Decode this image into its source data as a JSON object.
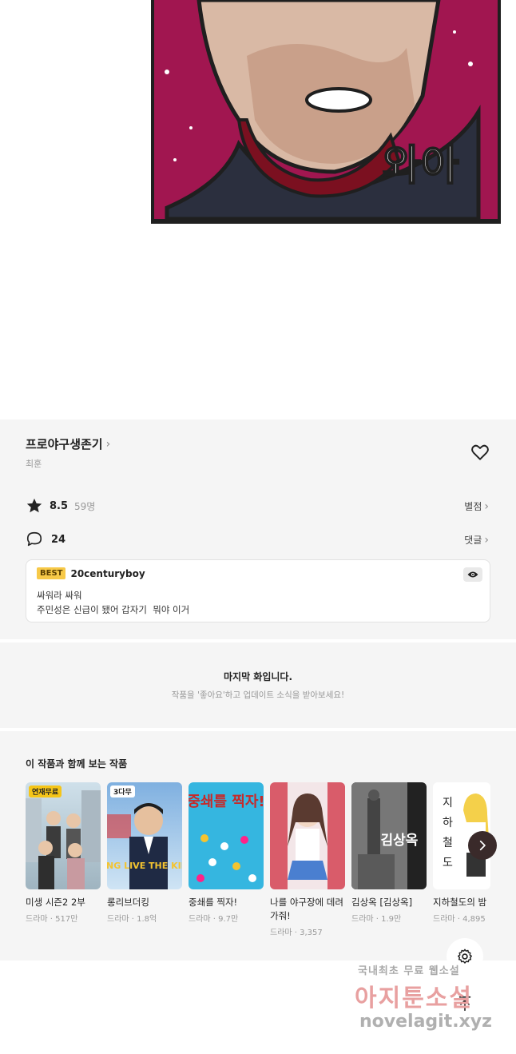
{
  "comic": {
    "panel_text": "와아"
  },
  "series": {
    "title": "프로야구생존기",
    "author": "최훈",
    "rating": "8.5",
    "rating_count": "59명",
    "rating_link": "별점",
    "comment_count": "24",
    "comment_link": "댓글"
  },
  "best_comment": {
    "badge": "BEST",
    "user": "20centuryboy",
    "lines": [
      "싸워라 싸워",
      "주민성은 신급이 됐어 갑자기  뭐야 이거"
    ]
  },
  "last_chapter": {
    "title": "마지막 화입니다.",
    "subtitle": "작품을 '좋아요'하고 업데이트 소식을 받아보세요!"
  },
  "recommendations": {
    "heading": "이 작품과 함께 보는 작품",
    "items": [
      {
        "name": "미생 시즌2 2부",
        "meta": "드라마 · 517만",
        "tag": "연재무료",
        "thumb_text": ""
      },
      {
        "name": "롱리브더킹",
        "meta": "드라마 · 1.8억",
        "tag": "3다무",
        "thumb_text": "LONG LIVE THE KING"
      },
      {
        "name": "중쇄를 찍자!",
        "meta": "드라마 · 9.7만",
        "tag": "",
        "thumb_text": "중쇄를 찍자!"
      },
      {
        "name": "나를 야구장에 데려가줘!",
        "meta": "드라마 · 3,357",
        "tag": "",
        "thumb_text": ""
      },
      {
        "name": "김상옥 [김상옥]",
        "meta": "드라마 · 1.9만",
        "tag": "",
        "thumb_text": "김상옥"
      },
      {
        "name": "지하철도의 밤",
        "meta": "드라마 · 4,895",
        "tag": "",
        "thumb_text": ""
      }
    ]
  },
  "watermark": {
    "line1": "국내최초 무료 웹소설",
    "line2": "아지툰소설",
    "line3": "novelagit.xyz"
  },
  "icons": {
    "star": "star-icon",
    "comment": "speech-bubble-icon",
    "heart": "heart-icon",
    "eye": "eye-icon",
    "next": "chevron-right-icon",
    "settings": "gear-icon",
    "top": "arrow-up-icon"
  },
  "colors": {
    "panel_bg": "#a11650",
    "best_badge": "#f7c948"
  }
}
